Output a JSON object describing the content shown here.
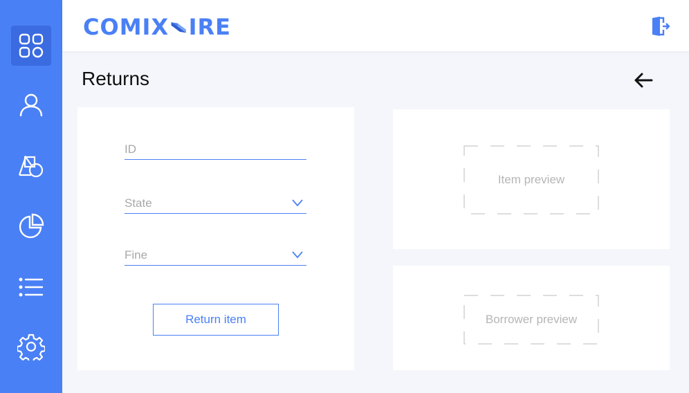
{
  "brand": {
    "logo_left": "COMIX",
    "logo_right": "IRE",
    "accent": "#4a80f5"
  },
  "sidebar": {
    "items": [
      {
        "name": "dashboard",
        "icon": "grid-icon",
        "active": true
      },
      {
        "name": "users",
        "icon": "user-icon"
      },
      {
        "name": "items",
        "icon": "shapes-icon"
      },
      {
        "name": "reports",
        "icon": "pie-chart-icon"
      },
      {
        "name": "list",
        "icon": "list-icon"
      },
      {
        "name": "settings",
        "icon": "gear-icon"
      }
    ]
  },
  "header": {
    "logout_icon": "logout-icon"
  },
  "page": {
    "title": "Returns",
    "back_icon": "arrow-left-icon"
  },
  "form": {
    "id_placeholder": "ID",
    "state_placeholder": "State",
    "fine_placeholder": "Fine",
    "submit_label": "Return item"
  },
  "previews": {
    "item_label": "Item preview",
    "borrower_label": "Borrower preview"
  }
}
